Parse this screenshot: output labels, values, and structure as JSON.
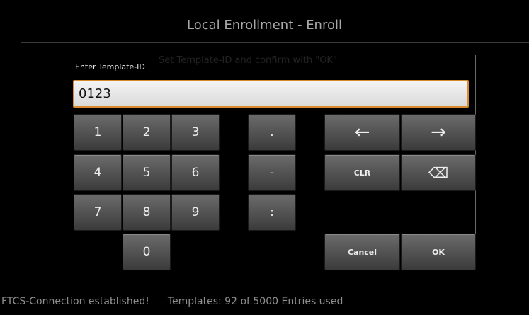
{
  "header": {
    "title": "Local Enrollment - Enroll"
  },
  "dialog": {
    "ghost_text": "Set Template-ID and confirm with \"OK\"",
    "prompt": "Enter Template-ID",
    "input_value": "0123"
  },
  "keypad": {
    "k1": "1",
    "k2": "2",
    "k3": "3",
    "k4": "4",
    "k5": "5",
    "k6": "6",
    "k7": "7",
    "k8": "8",
    "k9": "9",
    "k0": "0",
    "dot": ".",
    "dash": "-",
    "colon": ":",
    "left": "←",
    "right": "→",
    "clr": "CLR",
    "backspace": "⌫",
    "cancel": "Cancel",
    "ok": "OK"
  },
  "status": {
    "connection": "FTCS-Connection established!",
    "templates": "Templates: 92 of 5000 Entries used"
  },
  "colors": {
    "accent": "#d98a2f",
    "background": "#000000"
  }
}
